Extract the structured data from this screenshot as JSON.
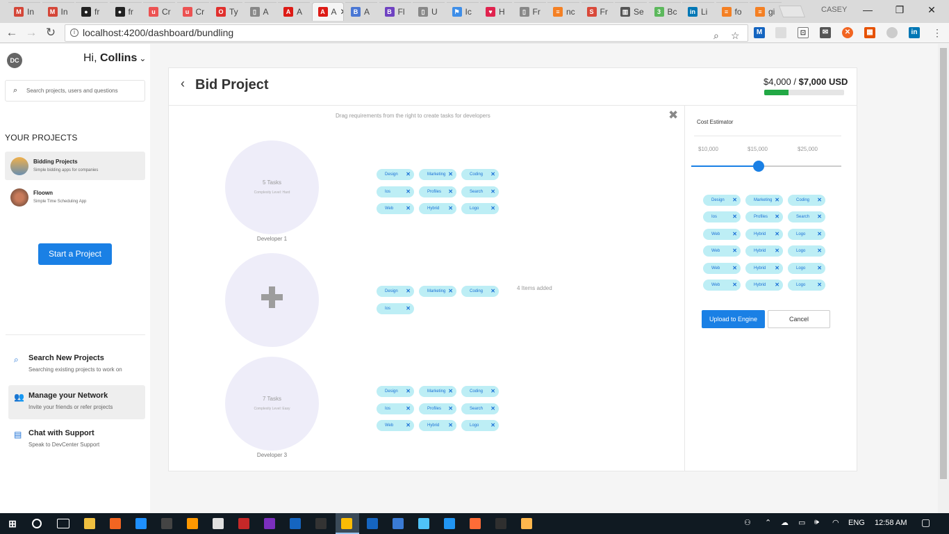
{
  "browser": {
    "tabs": [
      {
        "label": "In",
        "icon": "gmail-icon",
        "color": "#d44638",
        "glyph": "M"
      },
      {
        "label": "In",
        "icon": "gmail-icon",
        "color": "#d44638",
        "glyph": "M"
      },
      {
        "label": "fr",
        "icon": "github-icon",
        "color": "#222",
        "glyph": "●"
      },
      {
        "label": "fr",
        "icon": "github-icon",
        "color": "#222",
        "glyph": "●"
      },
      {
        "label": "Cr",
        "icon": "udemy-icon",
        "color": "#ec5252",
        "glyph": "u"
      },
      {
        "label": "Cr",
        "icon": "udemy-icon",
        "color": "#ec5252",
        "glyph": "u"
      },
      {
        "label": "Ty",
        "icon": "oracle-icon",
        "color": "#e0302d",
        "glyph": "O"
      },
      {
        "label": "A",
        "icon": "document-icon",
        "color": "#888",
        "glyph": "▯"
      },
      {
        "label": "A",
        "icon": "angular-icon",
        "color": "#dd1b16",
        "glyph": "A"
      },
      {
        "label": "A",
        "icon": "angular-icon",
        "color": "#dd1b16",
        "glyph": "A"
      },
      {
        "label": "A",
        "icon": "bootstrap-icon",
        "color": "#4a77d4",
        "glyph": "B"
      },
      {
        "label": "Fl",
        "icon": "bootstrap-icon",
        "color": "#6f42c1",
        "glyph": "B"
      },
      {
        "label": "U",
        "icon": "document-icon",
        "color": "#888",
        "glyph": "▯"
      },
      {
        "label": "Ic",
        "icon": "flag-icon",
        "color": "#3e8ee8",
        "glyph": "⚑"
      },
      {
        "label": "H",
        "icon": "nest-icon",
        "color": "#e0234e",
        "glyph": "♥"
      },
      {
        "label": "Fr",
        "icon": "document-icon",
        "color": "#888",
        "glyph": "▯"
      },
      {
        "label": "nc",
        "icon": "stackoverflow-icon",
        "color": "#f48024",
        "glyph": "≡"
      },
      {
        "label": "Fr",
        "icon": "scribd-icon",
        "color": "#d9493a",
        "glyph": "S"
      },
      {
        "label": "Se",
        "icon": "book-icon",
        "color": "#555",
        "glyph": "▥"
      },
      {
        "label": "Bc",
        "icon": "green-app-icon",
        "color": "#5cb85c",
        "glyph": "3"
      },
      {
        "label": "Li",
        "icon": "linkedin-icon",
        "color": "#0077b5",
        "glyph": "in"
      },
      {
        "label": "fo",
        "icon": "stackoverflow-icon",
        "color": "#f48024",
        "glyph": "≡"
      },
      {
        "label": "gi",
        "icon": "stackoverflow-icon",
        "color": "#f48024",
        "glyph": "≡"
      }
    ],
    "active_tab_index": 9,
    "profile": "CASEY",
    "url": "localhost:4200/dashboard/bundling"
  },
  "sidebar": {
    "logo": "DC",
    "greeting_prefix": "Hi, ",
    "user_name": "Collins",
    "search_placeholder": "Search projects, users and questions",
    "projects_heading": "YOUR PROJECTS",
    "projects": [
      {
        "name": "Bidding Projects",
        "desc": "Simple bidding apps for companies",
        "selected": true
      },
      {
        "name": "Floown",
        "desc": "Simple Time Scheduling App",
        "selected": false
      }
    ],
    "start_button": "Start a Project",
    "links": [
      {
        "title": "Search New Projects",
        "sub": "Searching existing projects to work on",
        "icon": "search-icon",
        "selected": false
      },
      {
        "title": "Manage your Network",
        "sub": "Invite your friends or refer projects",
        "icon": "users-icon",
        "selected": true
      },
      {
        "title": "Chat with Support",
        "sub": "Speak to DevCenter Support",
        "icon": "book-icon",
        "selected": false
      }
    ]
  },
  "card": {
    "back_icon": "chevron-left-icon",
    "title": "Bid Project",
    "budget_current": "$4,000",
    "budget_sep": " / ",
    "budget_total": "$7,000 USD",
    "budget_progress": 0.3,
    "hint": "Drag requirements from the right to create tasks for developers",
    "developers": [
      {
        "tasks": "5 Tasks",
        "level": "Complexity Level: Hard",
        "label": "Developer 1",
        "empty": false,
        "chips": [
          "Design",
          "Marketing",
          "Coding",
          "Ios",
          "Profiles",
          "Search",
          "Web",
          "Hybrid",
          "Logo"
        ]
      },
      {
        "tasks": "",
        "level": "",
        "label": "",
        "empty": true,
        "chips": [
          "Design",
          "Marketing",
          "Coding",
          "Ios"
        ]
      },
      {
        "tasks": "7 Tasks",
        "level": "Complexity Level: Easy",
        "label": "Developer 3",
        "empty": false,
        "chips": [
          "Design",
          "Marketing",
          "Coding",
          "Ios",
          "Profiles",
          "Search",
          "Web",
          "Hybrid",
          "Logo"
        ]
      }
    ],
    "items_added": "4 Items added"
  },
  "estimator": {
    "title": "Cost Estimator",
    "labels": [
      "$10,000",
      "$15,000",
      "$25,000"
    ],
    "slider_value": 0.45,
    "chips": [
      "Design",
      "Marketing",
      "Coding",
      "Ios",
      "Profiles",
      "Search",
      "Web",
      "Hybrid",
      "Logo",
      "Web",
      "Hybrid",
      "Logo",
      "Web",
      "Hybrid",
      "Logo",
      "Web",
      "Hybrid",
      "Logo"
    ],
    "upload_button": "Upload to Engine",
    "cancel_button": "Cancel"
  },
  "taskbar": {
    "apps": [
      "file-explorer-icon",
      "cube-icon",
      "edge-icon",
      "store-icon",
      "sublime-icon",
      "paint-icon",
      "filezilla-icon",
      "phpstorm-icon",
      "webstorm-icon",
      "intellij-icon",
      "chrome-icon",
      "sourcetree-icon",
      "calculator-icon",
      "desktop-icon",
      "mixer-icon",
      "postman-icon",
      "git-icon",
      "sloth-icon"
    ],
    "lang": "ENG",
    "time": "12:58 AM"
  }
}
